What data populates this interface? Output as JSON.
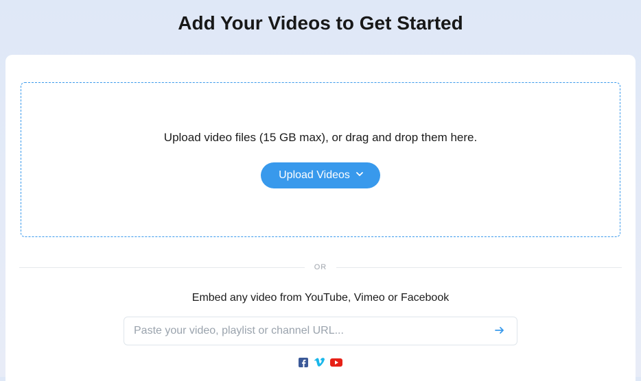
{
  "header": {
    "title": "Add Your Videos to Get Started"
  },
  "dropzone": {
    "instruction": "Upload video files (15 GB max), or drag and drop them here.",
    "button_label": "Upload Videos"
  },
  "divider": {
    "label": "OR"
  },
  "embed": {
    "instruction": "Embed any video from YouTube, Vimeo or Facebook",
    "placeholder": "Paste your video, playlist or channel URL...",
    "icons": [
      "facebook",
      "vimeo",
      "youtube"
    ]
  },
  "colors": {
    "accent": "#3899ec",
    "facebook": "#3b5998",
    "vimeo": "#1ab7ea",
    "youtube": "#e62117"
  }
}
